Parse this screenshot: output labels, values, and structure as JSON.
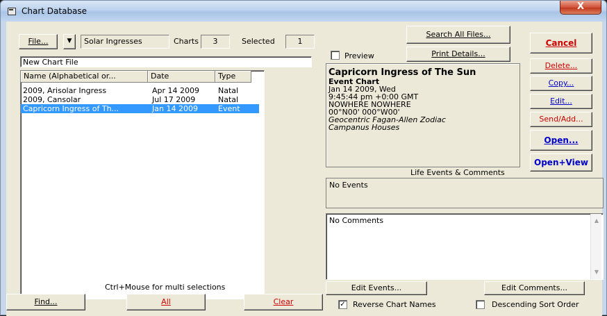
{
  "window": {
    "title": "Chart Database",
    "close_label": "X"
  },
  "toolbar": {
    "file_label": "File...",
    "file_name": "Solar Ingresses",
    "charts_label": "Charts",
    "charts_count": "3",
    "selected_label": "Selected",
    "selected_count": "1"
  },
  "file_description": "New Chart File",
  "list": {
    "columns": [
      "Name (Alphabetical or...",
      "Date",
      "Type"
    ],
    "rows": [
      {
        "name": "2009, Arisolar Ingress",
        "date": "Apr 14 2009",
        "type": "Natal"
      },
      {
        "name": "2009, Cansolar",
        "date": "Jul 17 2009",
        "type": "Natal"
      },
      {
        "name": "Capricorn Ingress of Th...",
        "date": "Jan 14 2009",
        "type": "Event"
      }
    ],
    "hint": "Ctrl+Mouse for multi selections"
  },
  "bottom_buttons": {
    "find": "Find...",
    "all": "All",
    "clear": "Clear"
  },
  "preview": {
    "checkbox_label": "Preview",
    "checked": false
  },
  "top_buttons": {
    "search_all": "Search All Files...",
    "print_details": "Print Details..."
  },
  "chart_info": {
    "title": "Capricorn Ingress of The Sun",
    "type": "Event Chart",
    "date": "Jan 14 2009, Wed",
    "time": "9:45:44 pm  +0:00 GMT",
    "location": "NOWHERE NOWHERE",
    "coords": "00°N00' 000°W00'",
    "zodiac": "Geocentric Fagan-Allen Zodiac",
    "houses": "Campanus Houses"
  },
  "life_events_label": "Life Events & Comments",
  "events_text": "No Events",
  "comments_text": "No Comments",
  "side_buttons": {
    "cancel": "Cancel",
    "delete": "Delete...",
    "copy": "Copy...",
    "edit": "Edit...",
    "send_add": "Send/Add...",
    "open": "Open...",
    "open_view": "Open+View"
  },
  "edit_buttons": {
    "edit_events": "Edit Events...",
    "edit_comments": "Edit Comments..."
  },
  "options": {
    "reverse_names": {
      "label": "Reverse Chart Names",
      "checked": true
    },
    "descending_sort": {
      "label": "Descending Sort Order",
      "checked": false
    }
  },
  "colors": {
    "accent_red": "#cc0000",
    "accent_blue": "#0000cc",
    "selection": "#3399ff"
  }
}
